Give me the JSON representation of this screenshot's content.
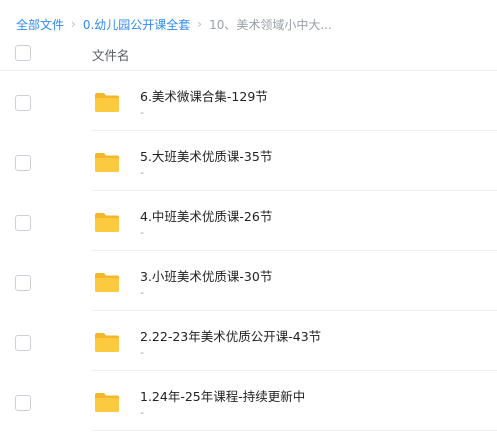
{
  "breadcrumb": {
    "items": [
      "全部文件",
      "0.幼儿园公开课全套",
      "10、美术领域小中大..."
    ]
  },
  "table": {
    "column_name_label": "文件名"
  },
  "files": [
    {
      "name": "6.美术微课合集-129节",
      "meta": "-"
    },
    {
      "name": "5.大班美术优质课-35节",
      "meta": "-"
    },
    {
      "name": "4.中班美术优质课-26节",
      "meta": "-"
    },
    {
      "name": "3.小班美术优质课-30节",
      "meta": "-"
    },
    {
      "name": "2.22-23年美术优质公开课-43节",
      "meta": "-"
    },
    {
      "name": "1.24年-25年课程-持续更新中",
      "meta": "-"
    }
  ],
  "icons": {
    "separator": "chevron-right-icon",
    "file": "folder-icon"
  },
  "colors": {
    "link": "#2f8cf4",
    "folder_back": "#f4b72c",
    "folder_front": "#fcca3f"
  }
}
